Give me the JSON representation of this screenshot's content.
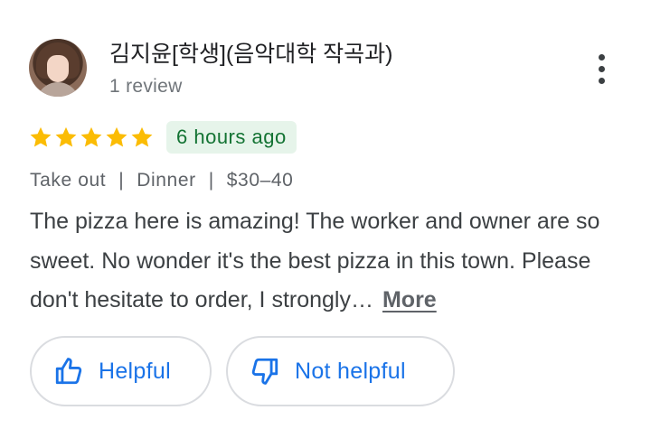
{
  "reviewer": {
    "name": "김지윤[학생](음악대학 작곡과)",
    "review_count": "1 review",
    "avatar_icon": "profile-photo"
  },
  "menu": {
    "icon": "more-vert-icon"
  },
  "rating": {
    "stars": 5,
    "max": 5,
    "star_color": "#fbbc04"
  },
  "time_ago": "6 hours ago",
  "meta": {
    "service": "Take out",
    "separator": "|",
    "meal": "Dinner",
    "price": "$30–40"
  },
  "review": {
    "text": "The pizza here is amazing! The worker and owner are so sweet. No wonder it's the best pizza in this town. Please don't hesitate to order, I strongly…",
    "more_label": "More"
  },
  "actions": {
    "helpful_label": "Helpful",
    "not_helpful_label": "Not helpful",
    "helpful_icon": "thumb-up-icon",
    "not_helpful_icon": "thumb-down-icon",
    "accent": "#1a73e8"
  }
}
